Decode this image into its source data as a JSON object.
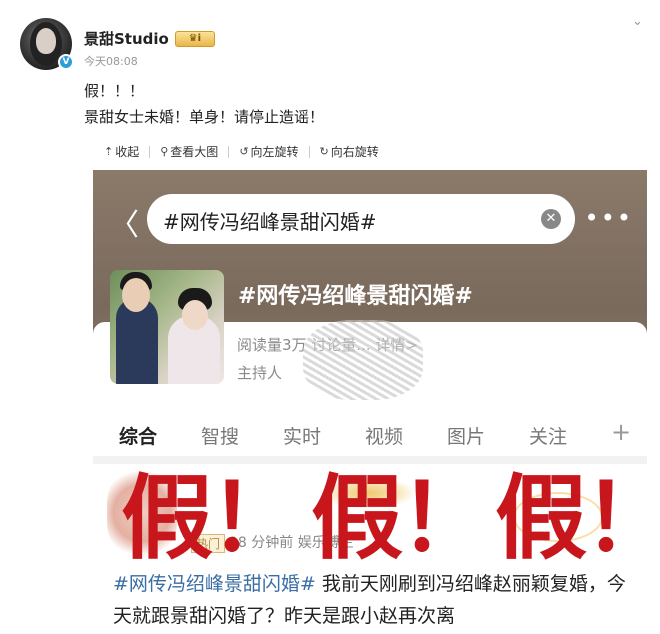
{
  "post": {
    "username": "景甜Studio",
    "vip_label": "♛ⅰ",
    "time": "今天08:08",
    "text_line1": "假！！！",
    "text_line2": "景甜女士未婚！单身！请停止造谣！"
  },
  "toolbar": {
    "collapse": "收起",
    "view_large": "查看大图",
    "rotate_left": "向左旋转",
    "rotate_right": "向右旋转"
  },
  "screenshot": {
    "search_text": "#网传冯绍峰景甜闪婚#",
    "topic_title": "#网传冯绍峰景甜闪婚#",
    "stats": "阅读量3万  讨论量... 详情>",
    "host": "主持人",
    "tabs": [
      "综合",
      "智搜",
      "实时",
      "视频",
      "图片",
      "关注"
    ],
    "tab_plus": "+",
    "hot_badge": "热门",
    "post_meta": "28 分钟前  娱乐博主",
    "post_tag": "#网传冯绍峰景甜闪婚#",
    "post_text": " 我前天刚刷到冯绍峰赵丽颖复婚，今天就跟景甜闪婚了？昨天是跟小赵再次离",
    "overlay": [
      "假！",
      "假！",
      "假！"
    ]
  },
  "colors": {
    "overlay_red": "#c8161d",
    "tag_blue": "#3a6ea5",
    "header_brown": "#7a6a5c"
  }
}
